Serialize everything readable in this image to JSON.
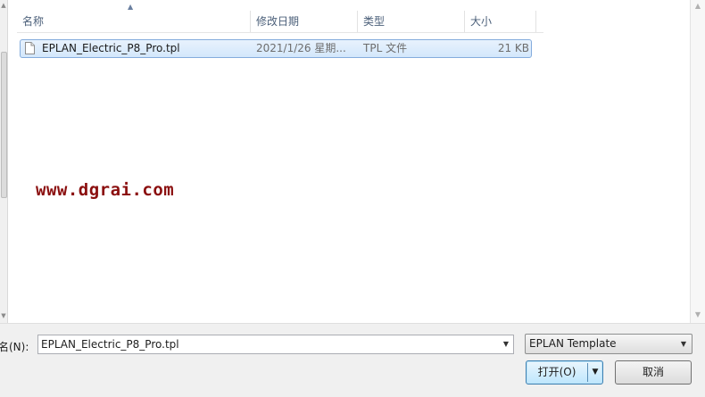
{
  "columns": {
    "name": "名称",
    "modified": "修改日期",
    "type": "类型",
    "size": "大小"
  },
  "files": [
    {
      "name": "EPLAN_Electric_P8_Pro.tpl",
      "modified": "2021/1/26 星期...",
      "type": "TPL 文件",
      "size": "21 KB",
      "selected": true
    }
  ],
  "watermark": "www.dgrai.com",
  "footer": {
    "filename_label": "名(N):",
    "filename_value": "EPLAN_Electric_P8_Pro.tpl",
    "filetype_value": "EPLAN Template",
    "open_label": "打开(O)",
    "cancel_label": "取消"
  },
  "colors": {
    "selection_bg": "#d3e7fb",
    "selection_border": "#84acdd",
    "header_text": "#4c607a",
    "watermark": "#8b0f0f"
  }
}
